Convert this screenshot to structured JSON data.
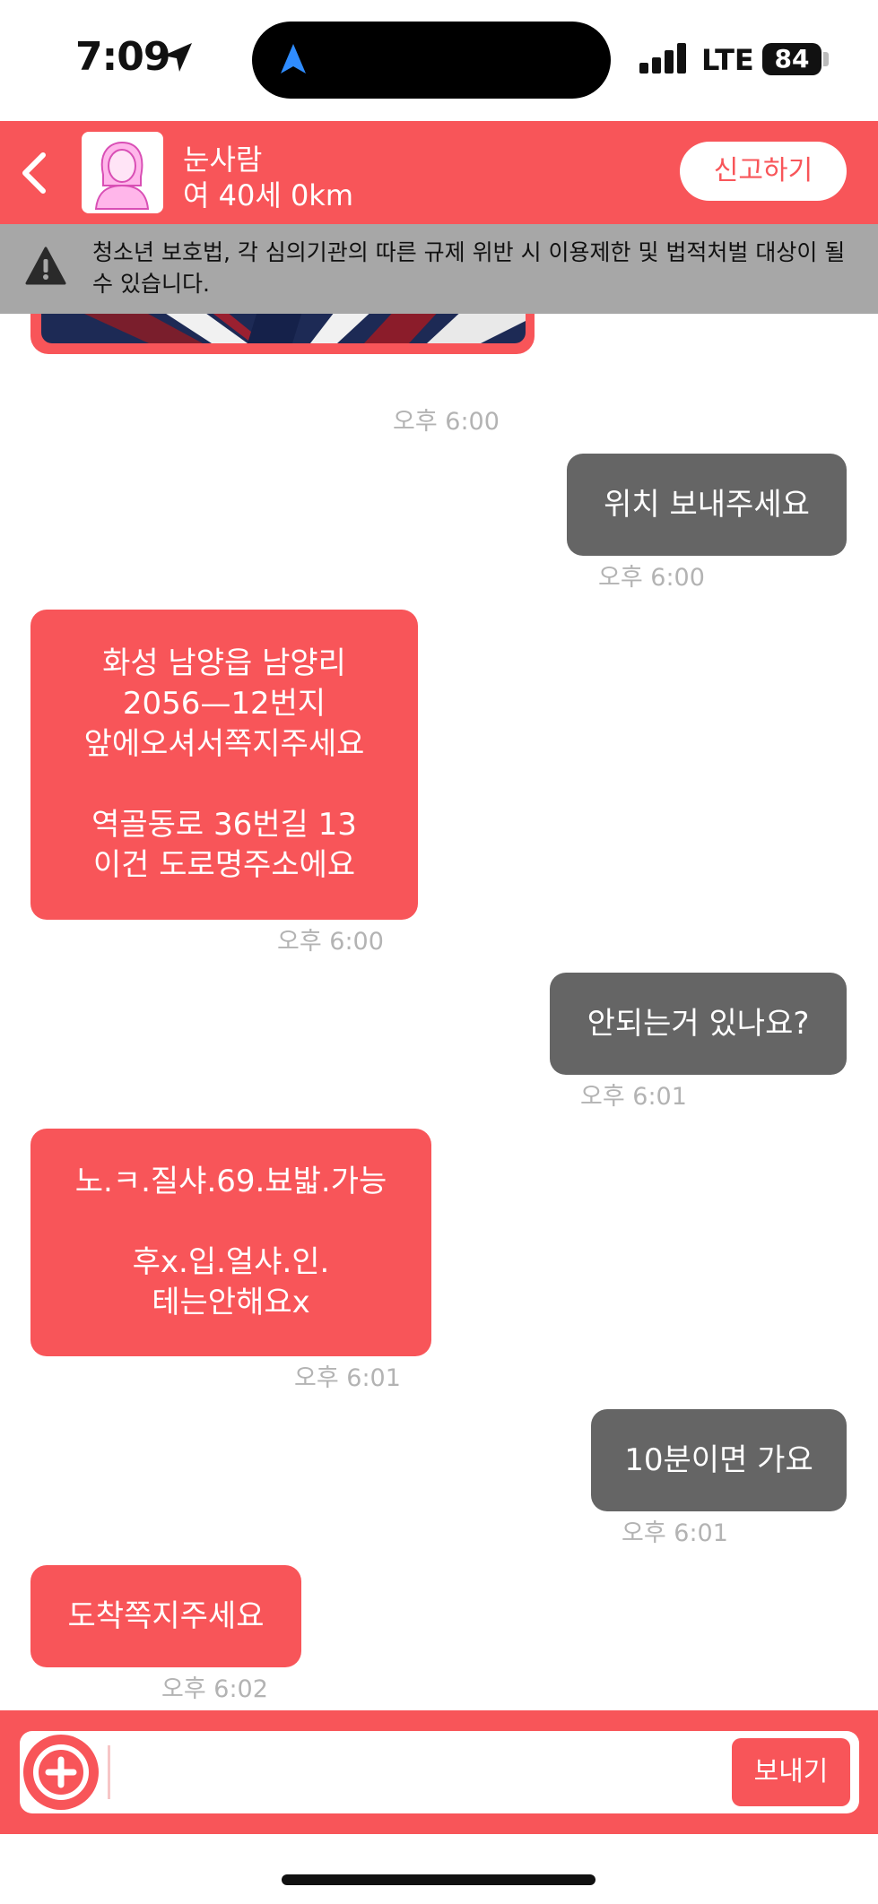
{
  "status_bar": {
    "time": "7:09",
    "network": "LTE",
    "battery": "84"
  },
  "header": {
    "name": "눈사람",
    "info": "여 40세 0km",
    "report_label": "신고하기",
    "bg_color": "#f85559"
  },
  "warning": {
    "text": "청소년 보호법, 각 심의기관의 따른 규제 위반 시 이용제한 및 법적처벌 대상이 될 수 있습니다."
  },
  "messages": [
    {
      "side": "in",
      "kind": "image",
      "time": "오후 6:00"
    },
    {
      "side": "out",
      "lines": [
        "위치 보내주세요"
      ],
      "time": "오후 6:00"
    },
    {
      "side": "in",
      "lines": [
        "화성 남양읍 남양리",
        "2056—12번지",
        "앞에오셔서쪽지주세요",
        "",
        "역골동로 36번길 13",
        "이건 도로명주소에요"
      ],
      "time": "오후 6:00"
    },
    {
      "side": "out",
      "lines": [
        "안되는거 있나요?"
      ],
      "time": "오후 6:01"
    },
    {
      "side": "in",
      "lines": [
        "노.ㅋ.질샤.69.뵤밟.가능",
        "",
        "후x.입.얼샤.인.",
        "테는안해요x"
      ],
      "time": "오후 6:01"
    },
    {
      "side": "out",
      "lines": [
        "10분이면 가요"
      ],
      "time": "오후 6:01"
    },
    {
      "side": "in",
      "lines": [
        "도착쪽지주세요"
      ],
      "time": "오후 6:02"
    }
  ],
  "composer": {
    "value": "",
    "send_label": "보내기"
  },
  "colors": {
    "incoming": "#f85559",
    "outgoing": "#656565",
    "timestamp": "#b3b3b3"
  }
}
